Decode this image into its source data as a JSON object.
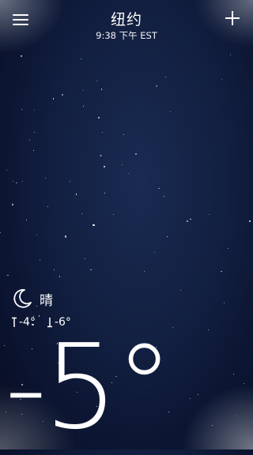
{
  "header": {
    "city": "纽约",
    "time": "9:38 下午 EST",
    "menu_icon": "hamburger-menu-icon",
    "add_icon": "plus-icon"
  },
  "weather": {
    "condition_icon": "moon-icon",
    "condition": "晴",
    "high": "-4°",
    "low": "-6°",
    "current_temp": "-5°"
  },
  "colors": {
    "sky_top": "#0b1430",
    "sky_mid": "#1a2a52",
    "text": "#ffffff"
  }
}
